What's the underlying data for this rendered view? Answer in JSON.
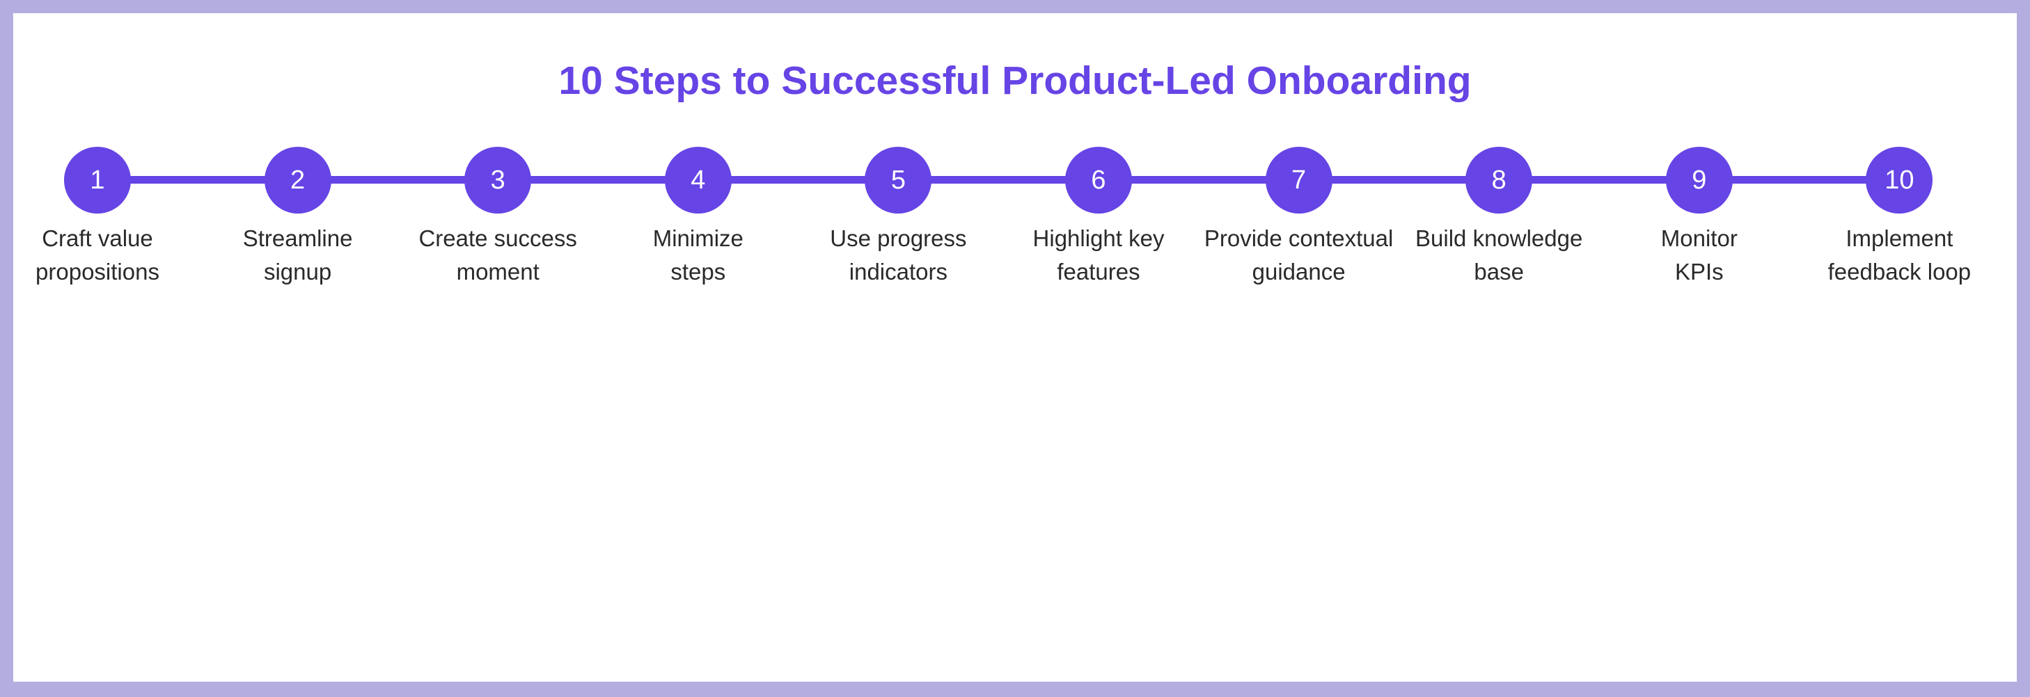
{
  "title": "10 Steps to Successful Product-Led Onboarding",
  "colors": {
    "accent": "#6644e5",
    "frame": "#b4aee0",
    "text": "#2a2a2a"
  },
  "steps": [
    {
      "number": "1",
      "label": "Craft value\npropositions"
    },
    {
      "number": "2",
      "label": "Streamline\nsignup"
    },
    {
      "number": "3",
      "label": "Create success\nmoment"
    },
    {
      "number": "4",
      "label": "Minimize\nsteps"
    },
    {
      "number": "5",
      "label": "Use progress\nindicators"
    },
    {
      "number": "6",
      "label": "Highlight key\nfeatures"
    },
    {
      "number": "7",
      "label": "Provide contextual\nguidance"
    },
    {
      "number": "8",
      "label": "Build knowledge\nbase"
    },
    {
      "number": "9",
      "label": "Monitor\nKPIs"
    },
    {
      "number": "10",
      "label": "Implement\nfeedback loop"
    }
  ]
}
